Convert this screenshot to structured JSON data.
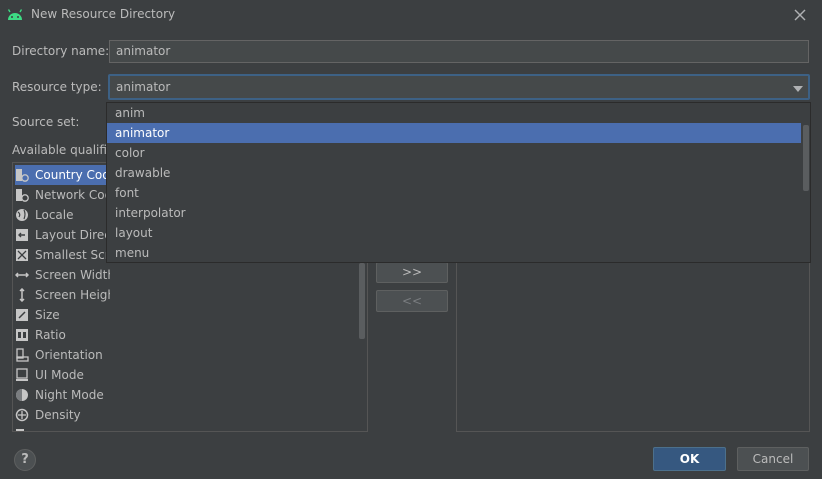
{
  "dialog": {
    "title": "New Resource Directory",
    "icon": "android-icon",
    "accent_color": "#4b6eaf"
  },
  "form": {
    "directory_name_label": "Directory name:",
    "directory_name_value": "animator",
    "resource_type_label": "Resource type:",
    "resource_type_value": "animator",
    "source_set_label": "Source set:",
    "available_qualifiers_label": "Available qualifier"
  },
  "qualifiers": [
    {
      "label": "Country Code",
      "icon": "country-code-icon"
    },
    {
      "label": "Network Code",
      "icon": "network-code-icon"
    },
    {
      "label": "Locale",
      "icon": "globe-icon"
    },
    {
      "label": "Layout Directi",
      "icon": "layout-direction-icon"
    },
    {
      "label": "Smallest Scree",
      "icon": "smallest-screen-icon"
    },
    {
      "label": "Screen Width",
      "icon": "screen-width-icon"
    },
    {
      "label": "Screen Height",
      "icon": "screen-height-icon"
    },
    {
      "label": "Size",
      "icon": "size-icon"
    },
    {
      "label": "Ratio",
      "icon": "ratio-icon"
    },
    {
      "label": "Orientation",
      "icon": "orientation-icon"
    },
    {
      "label": "UI Mode",
      "icon": "ui-mode-icon"
    },
    {
      "label": "Night Mode",
      "icon": "night-mode-icon"
    },
    {
      "label": "Density",
      "icon": "density-icon"
    }
  ],
  "transfer": {
    "add_label": ">>",
    "remove_label": "<<"
  },
  "dropdown": {
    "options": [
      "anim",
      "animator",
      "color",
      "drawable",
      "font",
      "interpolator",
      "layout",
      "menu"
    ],
    "selected": "animator"
  },
  "buttons": {
    "ok": "OK",
    "cancel": "Cancel",
    "help": "?"
  }
}
